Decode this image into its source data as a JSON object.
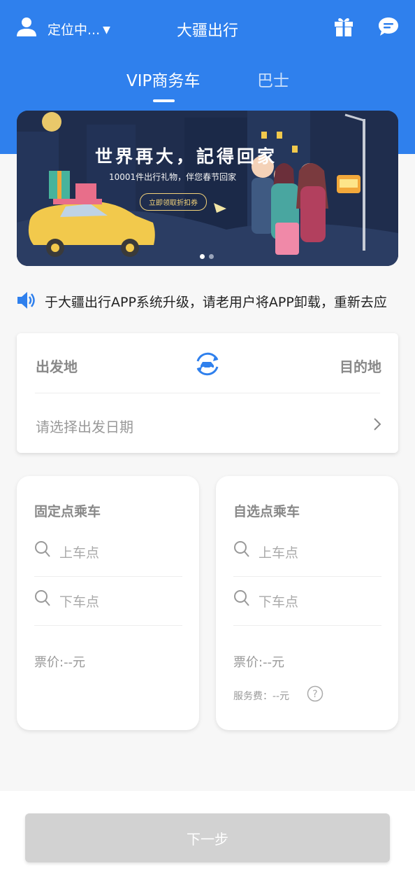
{
  "header": {
    "location": "定位中...",
    "title": "大疆出行",
    "background_color": "#2f80ed"
  },
  "tabs": [
    {
      "label": "VIP商务车",
      "active": true
    },
    {
      "label": "巴士",
      "active": false
    }
  ],
  "banner": {
    "headline": "世界再大，記得回家",
    "subline": "10001件出行礼物，伴您春节回家",
    "cta": "立即领取折扣券",
    "slide_count": 2,
    "active_slide": 1
  },
  "notice": {
    "icon": "speaker-icon",
    "text": "于大疆出行APP系统升级，请老用户将APP卸载，重新去应"
  },
  "route": {
    "origin_label": "出发地",
    "destination_label": "目的地",
    "date_placeholder": "请选择出发日期"
  },
  "cards": {
    "fixed": {
      "title": "固定点乘车",
      "pickup": "上车点",
      "dropoff": "下车点",
      "price": "票价:--元"
    },
    "custom": {
      "title": "自选点乘车",
      "pickup": "上车点",
      "dropoff": "下车点",
      "price": "票价:--元",
      "fee": "服务费：--元"
    }
  },
  "footer": {
    "next_label": "下一步",
    "button_color": "#d2d2d2"
  }
}
